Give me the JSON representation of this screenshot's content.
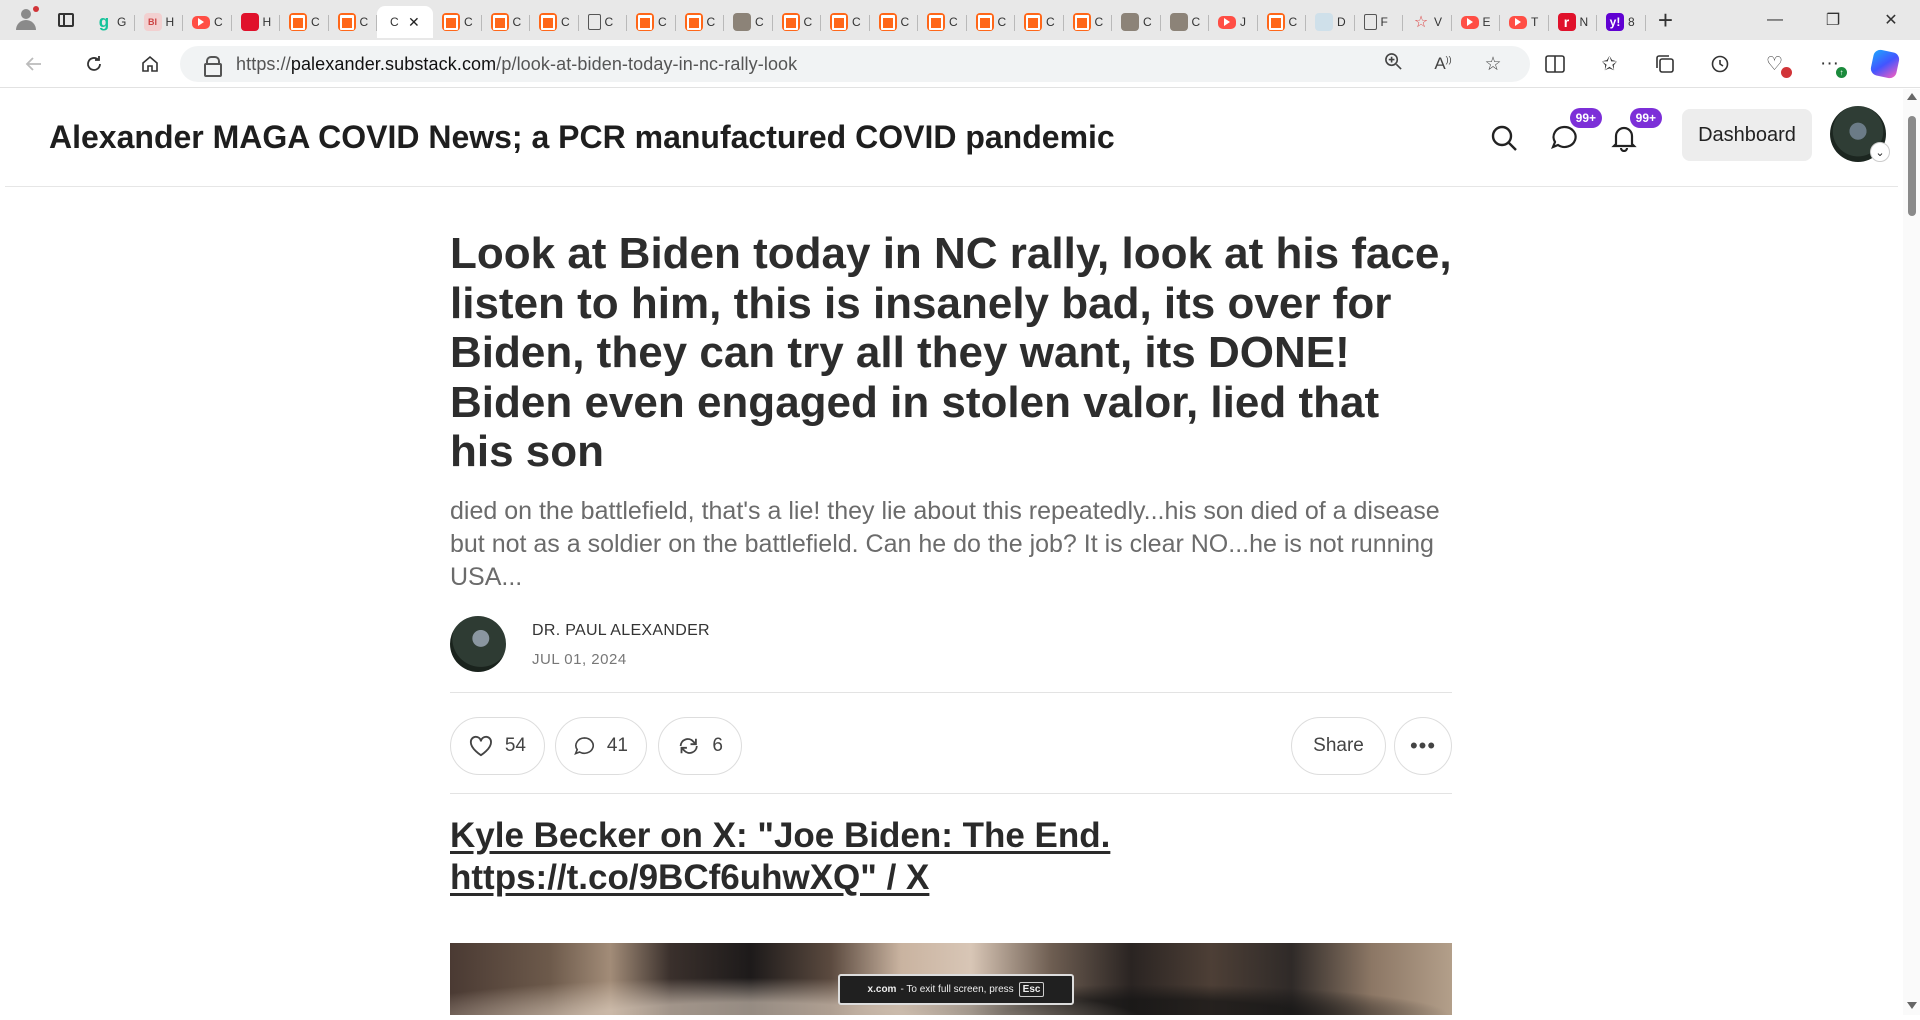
{
  "browser": {
    "url_prefix": "https://",
    "url_host": "palexander.substack.com",
    "url_path": "/p/look-at-biden-today-in-nc-rally-look",
    "tabs": [
      {
        "icon": "grammarly-icon",
        "label": "g",
        "title": "G"
      },
      {
        "icon": "bi-icon",
        "label": "BI",
        "title": "H"
      },
      {
        "icon": "youtube-icon",
        "label": "",
        "title": "C"
      },
      {
        "icon": "red-app-icon",
        "label": "",
        "title": "H"
      },
      {
        "icon": "substack-icon",
        "label": "",
        "title": "C"
      },
      {
        "icon": "substack-icon",
        "label": "",
        "title": "C"
      },
      {
        "icon": "active",
        "label": "",
        "title": "C"
      },
      {
        "icon": "substack-icon",
        "label": "",
        "title": "C"
      },
      {
        "icon": "substack-icon",
        "label": "",
        "title": "C"
      },
      {
        "icon": "substack-icon",
        "label": "",
        "title": "C"
      },
      {
        "icon": "document-icon",
        "label": "",
        "title": "C"
      },
      {
        "icon": "substack-icon",
        "label": "",
        "title": "C"
      },
      {
        "icon": "substack-icon",
        "label": "",
        "title": "C"
      },
      {
        "icon": "thumbnail-icon",
        "label": "",
        "title": "C"
      },
      {
        "icon": "substack-icon",
        "label": "",
        "title": "C"
      },
      {
        "icon": "substack-icon",
        "label": "",
        "title": "C"
      },
      {
        "icon": "substack-icon",
        "label": "",
        "title": "C"
      },
      {
        "icon": "substack-icon",
        "label": "",
        "title": "C"
      },
      {
        "icon": "substack-icon",
        "label": "",
        "title": "C"
      },
      {
        "icon": "substack-icon",
        "label": "",
        "title": "C"
      },
      {
        "icon": "substack-icon",
        "label": "",
        "title": "C"
      },
      {
        "icon": "thumbnail-icon",
        "label": "",
        "title": "C"
      },
      {
        "icon": "thumbnail-icon",
        "label": "",
        "title": "C"
      },
      {
        "icon": "youtube-icon",
        "label": "",
        "title": "J"
      },
      {
        "icon": "substack-icon",
        "label": "",
        "title": "C"
      },
      {
        "icon": "light-icon",
        "label": "",
        "title": "D"
      },
      {
        "icon": "document-icon",
        "label": "",
        "title": "F"
      },
      {
        "icon": "star-icon",
        "label": "☆",
        "title": "V"
      },
      {
        "icon": "youtube-icon",
        "label": "",
        "title": "E"
      },
      {
        "icon": "youtube-icon",
        "label": "",
        "title": "T"
      },
      {
        "icon": "r-icon",
        "label": "r",
        "title": "N"
      },
      {
        "icon": "yahoo-icon",
        "label": "y!",
        "title": "8"
      }
    ],
    "active_tab_close": "✕"
  },
  "site": {
    "title": "Alexander MAGA COVID News; a PCR manufactured COVID pandemic",
    "chat_badge": "99+",
    "notif_badge": "99+",
    "dashboard_label": "Dashboard"
  },
  "post": {
    "title": "Look at Biden today in NC rally, look at his face, listen to him, this is insanely bad, its over for Biden, they can try all they want, its DONE! Biden even engaged in stolen valor, lied that his son",
    "subtitle": "died on the battlefield, that's a lie! they lie about this repeatedly...his son died of a disease but not as a soldier on the battlefield. Can he do the job? It is clear NO...he is not running USA...",
    "author": "DR. PAUL ALEXANDER",
    "date": "JUL 01, 2024",
    "likes": "54",
    "comments": "41",
    "restacks": "6",
    "share_label": "Share",
    "more_label": "•••",
    "embed_title": "Kyle Becker on X: \"Joe Biden: The End. https://t.co/9BCf6uhwXQ\" / X"
  },
  "fullscreen_toast": {
    "site": "x.com",
    "message": " -  To exit full screen, press",
    "key": "Esc"
  }
}
